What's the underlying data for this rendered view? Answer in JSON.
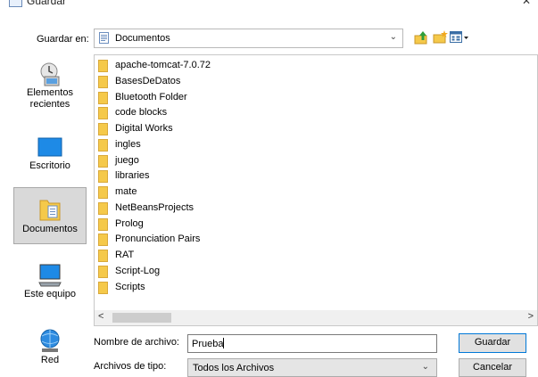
{
  "window": {
    "title": "Guardar",
    "close_glyph": "✕"
  },
  "toolbar": {
    "save_in_label": "Guardar en:",
    "save_in_value": "Documentos",
    "icons": [
      "up-folder-icon",
      "new-folder-icon",
      "view-menu-icon"
    ]
  },
  "places": [
    {
      "label": "Elementos recientes",
      "icon": "recent-items-icon",
      "selected": false
    },
    {
      "label": "Escritorio",
      "icon": "desktop-icon",
      "selected": false
    },
    {
      "label": "Documentos",
      "icon": "documents-icon",
      "selected": true
    },
    {
      "label": "Este equipo",
      "icon": "computer-icon",
      "selected": false
    },
    {
      "label": "Red",
      "icon": "network-icon",
      "selected": false
    }
  ],
  "files": [
    "apache-tomcat-7.0.72",
    "BasesDeDatos",
    "Bluetooth Folder",
    "code blocks",
    "Digital Works",
    "ingles",
    "juego",
    "libraries",
    "mate",
    "NetBeansProjects",
    "Prolog",
    "Pronunciation Pairs",
    "RAT",
    "Script-Log",
    "Scripts"
  ],
  "scroll": {
    "left_glyph": "<",
    "right_glyph": ">"
  },
  "form": {
    "filename_label": "Nombre de archivo:",
    "filename_value": "Prueba",
    "filetype_label": "Archivos de tipo:",
    "filetype_value": "Todos los Archivos"
  },
  "buttons": {
    "save": "Guardar",
    "cancel": "Cancelar"
  },
  "colors": {
    "folder": "#f5c94a",
    "selected_place": "#d9d9d9",
    "default_button_border": "#0078d7"
  }
}
